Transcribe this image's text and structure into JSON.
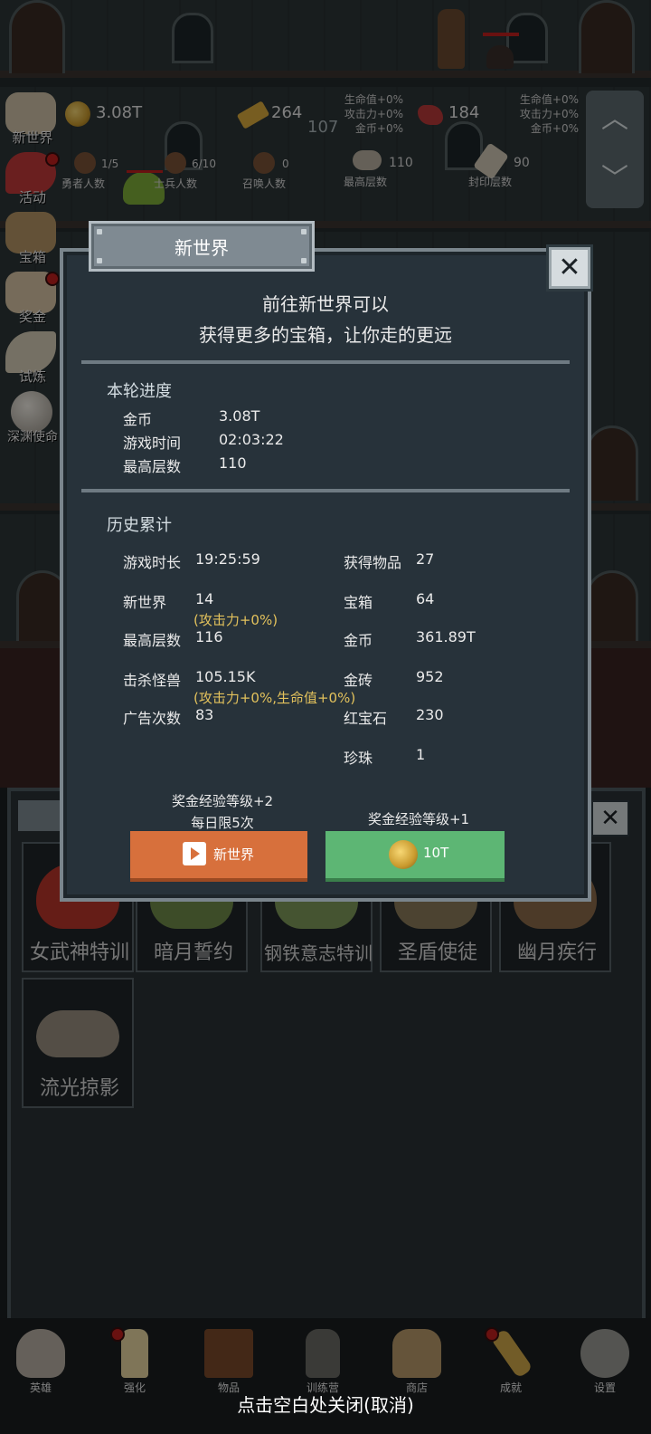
{
  "hud": {
    "gold_value": "3.08T",
    "bar_value": "264",
    "ruby_value": "184",
    "floor_number": "107",
    "bonus_lines_1": [
      "生命值+0%",
      "攻击力+0%",
      "金币+0%"
    ],
    "bonus_lines_2": [
      "生命值+0%",
      "攻击力+0%",
      "金币+0%"
    ],
    "stats": [
      {
        "value": "1/5",
        "label": "勇者人数"
      },
      {
        "value": "6/10",
        "label": "士兵人数"
      },
      {
        "value": "0",
        "label": "召唤人数"
      },
      {
        "value": "110",
        "label": "最高层数"
      },
      {
        "value": "90",
        "label": "封印层数"
      }
    ]
  },
  "sidebar": {
    "items": [
      {
        "label": "新世界",
        "icon": "stone-tablet-icon"
      },
      {
        "label": "活动",
        "icon": "heart-icon"
      },
      {
        "label": "宝箱",
        "icon": "chest-icon"
      },
      {
        "label": "奖金",
        "icon": "letter-icon"
      },
      {
        "label": "试炼",
        "icon": "feather-icon"
      },
      {
        "label": "深渊使命",
        "icon": "orb-icon"
      }
    ]
  },
  "dialog": {
    "title": "新世界",
    "intro_line1": "前往新世界可以",
    "intro_line2": "获得更多的宝箱，让你走的更远",
    "round_heading": "本轮进度",
    "round_rows": [
      {
        "label": "金币",
        "value": "3.08T"
      },
      {
        "label": "游戏时间",
        "value": "02:03:22"
      },
      {
        "label": "最高层数",
        "value": "110"
      }
    ],
    "history_heading": "历史累计",
    "history_left": [
      {
        "label": "游戏时长",
        "value": "19:25:59",
        "note": ""
      },
      {
        "label": "新世界",
        "value": "14",
        "note": "(攻击力+0%)"
      },
      {
        "label": "最高层数",
        "value": "116",
        "note": ""
      },
      {
        "label": "击杀怪兽",
        "value": "105.15K",
        "note": "(攻击力+0%,生命值+0%)"
      },
      {
        "label": "广告次数",
        "value": "83",
        "note": ""
      }
    ],
    "history_right": [
      {
        "label": "获得物品",
        "value": "27"
      },
      {
        "label": "宝箱",
        "value": "64"
      },
      {
        "label": "金币",
        "value": "361.89T"
      },
      {
        "label": "金砖",
        "value": "952"
      },
      {
        "label": "红宝石",
        "value": "230"
      },
      {
        "label": "珍珠",
        "value": "1"
      }
    ],
    "ad_caption_line1": "奖金经验等级+2",
    "ad_caption_line2": "每日限5次",
    "ad_button_label": "新世界",
    "gold_caption": "奖金经验等级+1",
    "gold_button_label": "10T"
  },
  "skills": [
    {
      "name": "女武神特训",
      "color": "#b8352a"
    },
    {
      "name": "暗月誓约",
      "color": "#6f8a4a"
    },
    {
      "name": "钢铁意志特训",
      "color": "#7f9a5a"
    },
    {
      "name": "圣盾使徒",
      "color": "#8a7a5a"
    },
    {
      "name": "幽月疾行",
      "color": "#8a6a4a"
    },
    {
      "name": "流光掠影",
      "color": "#9a8f80"
    }
  ],
  "bottom_nav": [
    {
      "label": "英雄",
      "icon": "skull-icon",
      "dot": false
    },
    {
      "label": "强化",
      "icon": "candle-icon",
      "dot": true
    },
    {
      "label": "物品",
      "icon": "book-icon",
      "dot": false
    },
    {
      "label": "训练营",
      "icon": "lantern-icon",
      "dot": false
    },
    {
      "label": "商店",
      "icon": "mug-icon",
      "dot": false
    },
    {
      "label": "成就",
      "icon": "key-icon",
      "dot": true
    },
    {
      "label": "设置",
      "icon": "gear-icon",
      "dot": false
    }
  ],
  "close_hint": "点击空白处关闭(取消)"
}
